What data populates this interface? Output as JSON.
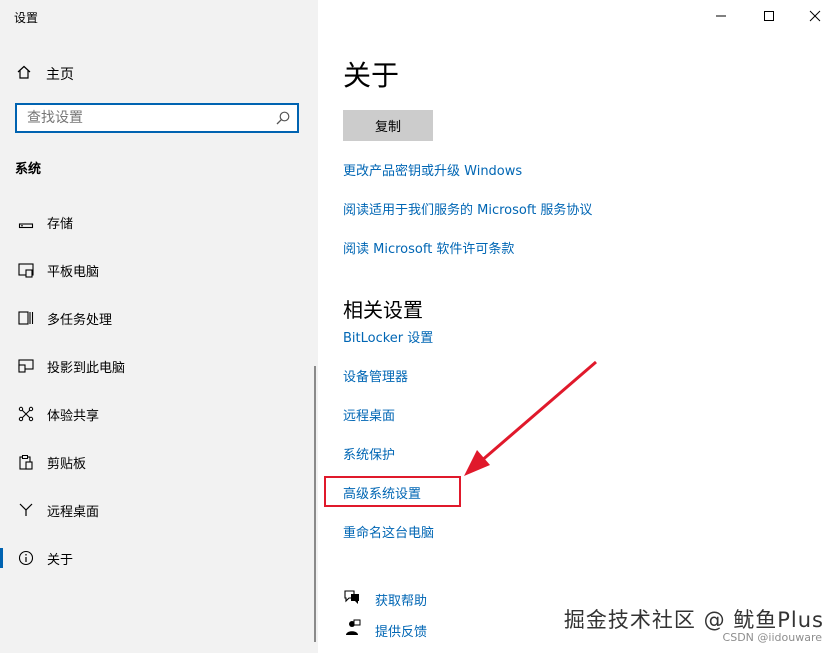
{
  "window": {
    "title": "设置"
  },
  "sidebar": {
    "home_label": "主页",
    "search_placeholder": "查找设置",
    "section_title": "系统",
    "items": [
      {
        "label": "存储",
        "icon": "storage-icon"
      },
      {
        "label": "平板电脑",
        "icon": "tablet-icon"
      },
      {
        "label": "多任务处理",
        "icon": "multitasking-icon"
      },
      {
        "label": "投影到此电脑",
        "icon": "projecting-icon"
      },
      {
        "label": "体验共享",
        "icon": "shared-experiences-icon"
      },
      {
        "label": "剪贴板",
        "icon": "clipboard-icon"
      },
      {
        "label": "远程桌面",
        "icon": "remote-desktop-icon"
      },
      {
        "label": "关于",
        "icon": "info-icon",
        "selected": true
      }
    ]
  },
  "main": {
    "title": "关于",
    "copy_button": "复制",
    "links": [
      "更改产品密钥或升级 Windows",
      "阅读适用于我们服务的 Microsoft 服务协议",
      "阅读 Microsoft 软件许可条款"
    ],
    "related_title": "相关设置",
    "related_links": [
      "BitLocker 设置",
      "设备管理器",
      "远程桌面",
      "系统保护",
      "高级系统设置",
      "重命名这台电脑"
    ],
    "help": {
      "get_help": "获取帮助",
      "feedback": "提供反馈"
    }
  },
  "watermark": {
    "primary": "掘金技术社区 @ 鱿鱼Plus",
    "secondary": "CSDN @iidouware"
  },
  "colors": {
    "accent": "#0063b1",
    "link": "#0066b4",
    "annotation": "#e0192b",
    "sidebar_bg": "#f2f2f2"
  }
}
